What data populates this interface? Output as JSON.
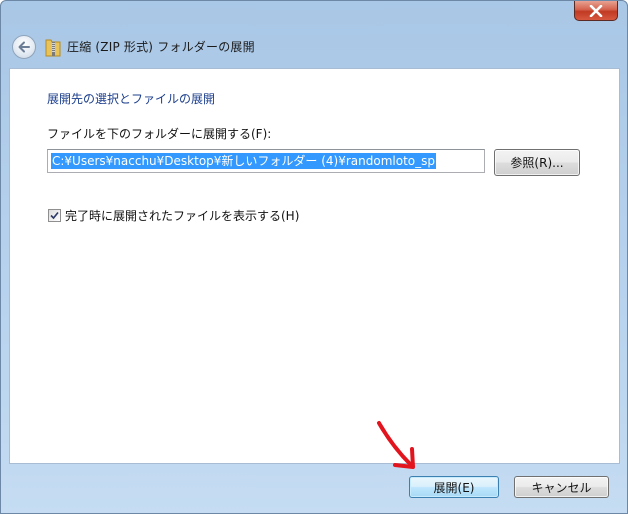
{
  "window": {
    "title": "圧縮 (ZIP 形式) フォルダーの展開",
    "close_icon": "close-icon"
  },
  "header": {
    "back_icon": "back-arrow-icon",
    "app_icon": "zip-folder-icon"
  },
  "content": {
    "section_title": "展開先の選択とファイルの展開",
    "destination_label": "ファイルを下のフォルダーに展開する(F):",
    "destination_path": "C:¥Users¥nacchu¥Desktop¥新しいフォルダー (4)¥randomloto_sp",
    "browse_label": "参照(R)...",
    "show_files_checked": true,
    "show_files_label": "完了時に展開されたファイルを表示する(H)"
  },
  "footer": {
    "extract_label": "展開(E)",
    "cancel_label": "キャンセル"
  },
  "colors": {
    "accent_title": "#1d3f8e",
    "selection": "#3399ff",
    "annotation_arrow": "#e2141e"
  }
}
